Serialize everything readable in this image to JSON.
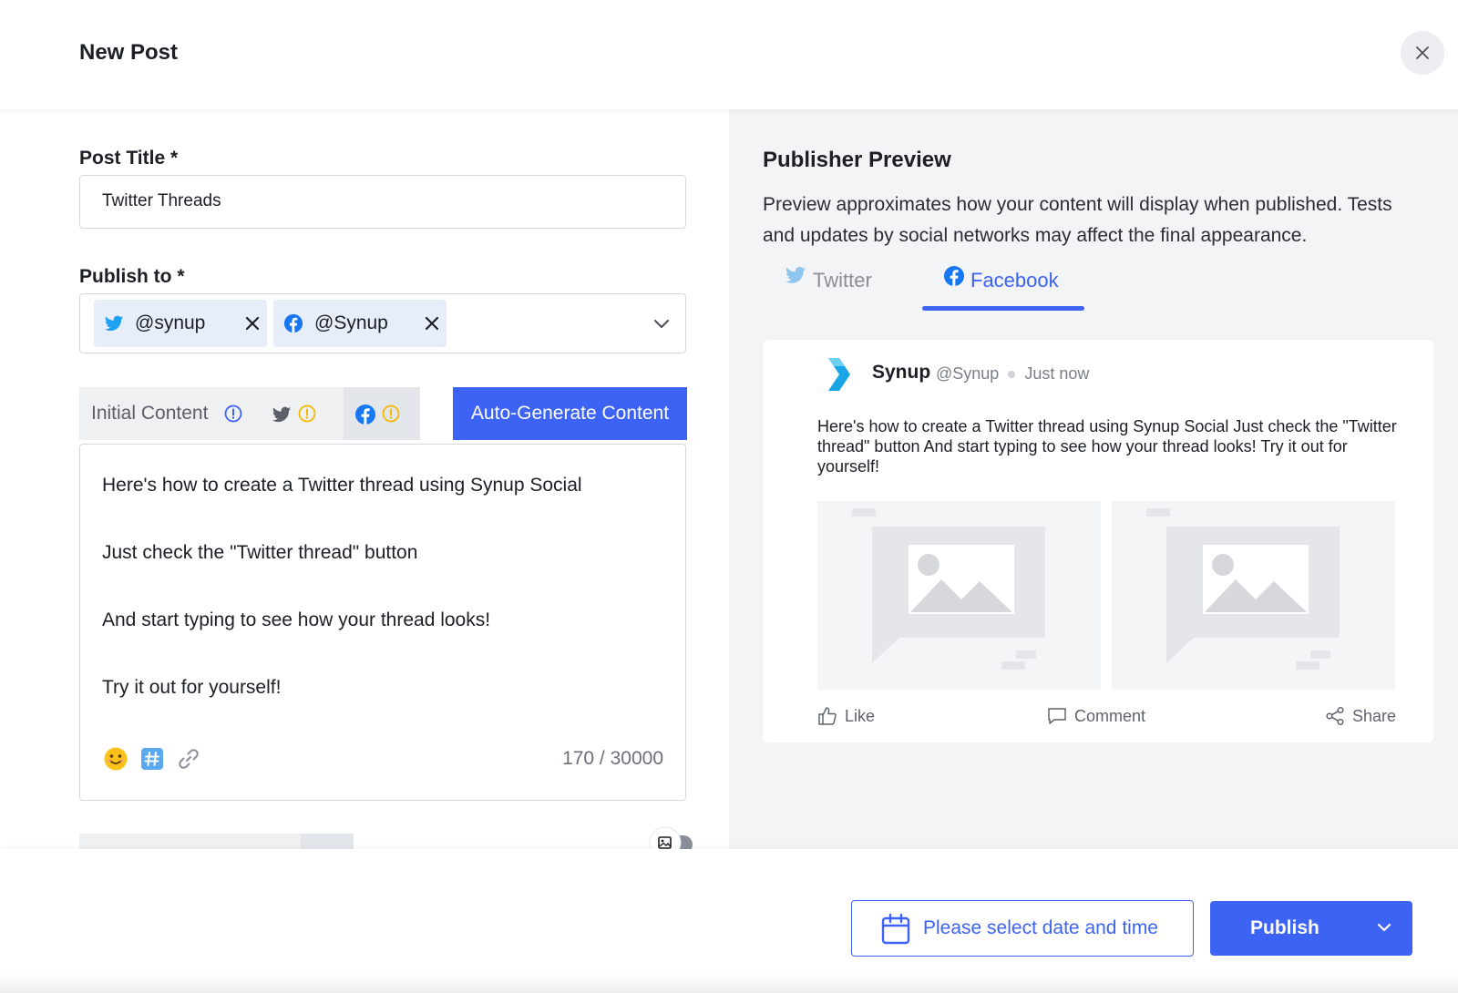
{
  "header": {
    "title": "New Post",
    "close_icon": "close-icon"
  },
  "form": {
    "post_title_label": "Post Title *",
    "post_title_value": "Twitter Threads",
    "publish_to_label": "Publish to *",
    "accounts": [
      {
        "network": "twitter",
        "icon": "twitter-icon",
        "handle": "@synup"
      },
      {
        "network": "facebook",
        "icon": "facebook-icon",
        "handle": "@Synup"
      }
    ],
    "content_tabs": {
      "initial_label": "Initial Content",
      "initial_icon": "info-icon",
      "twitter_icon": "twitter-icon",
      "twitter_status_icon": "warning-icon",
      "facebook_icon": "facebook-icon",
      "facebook_status_icon": "warning-icon"
    },
    "auto_generate_label": "Auto-Generate Content",
    "editor_lines": [
      "Here's how to create a Twitter thread using Synup Social",
      "Just check the \"Twitter thread\" button",
      "And start typing to see how your thread looks!",
      "Try it out for yourself!"
    ],
    "tools": [
      "emoji-icon",
      "hashtag-icon",
      "link-icon"
    ],
    "char_count": "170 / 30000"
  },
  "preview": {
    "title": "Publisher Preview",
    "description": "Preview approximates how your content will display when published. Tests and updates by social networks may affect the final appearance.",
    "tabs": [
      {
        "label": "Twitter",
        "icon": "twitter-icon",
        "active": false
      },
      {
        "label": "Facebook",
        "icon": "facebook-icon",
        "active": true
      }
    ],
    "card": {
      "name": "Synup",
      "handle": "@Synup",
      "time": "Just now",
      "text": "Here's how to create a Twitter thread using Synup Social Just check the \"Twitter thread\" button And start typing to see how your thread looks! Try it out for yourself!",
      "actions": {
        "like": "Like",
        "comment": "Comment",
        "share": "Share"
      }
    }
  },
  "footer": {
    "date_label": "Please select date and time",
    "date_icon": "calendar-icon",
    "publish_label": "Publish"
  },
  "colors": {
    "accent": "#3d63f5",
    "twitter": "#1da1f2",
    "facebook": "#1877f2",
    "warning": "#f5b800"
  }
}
